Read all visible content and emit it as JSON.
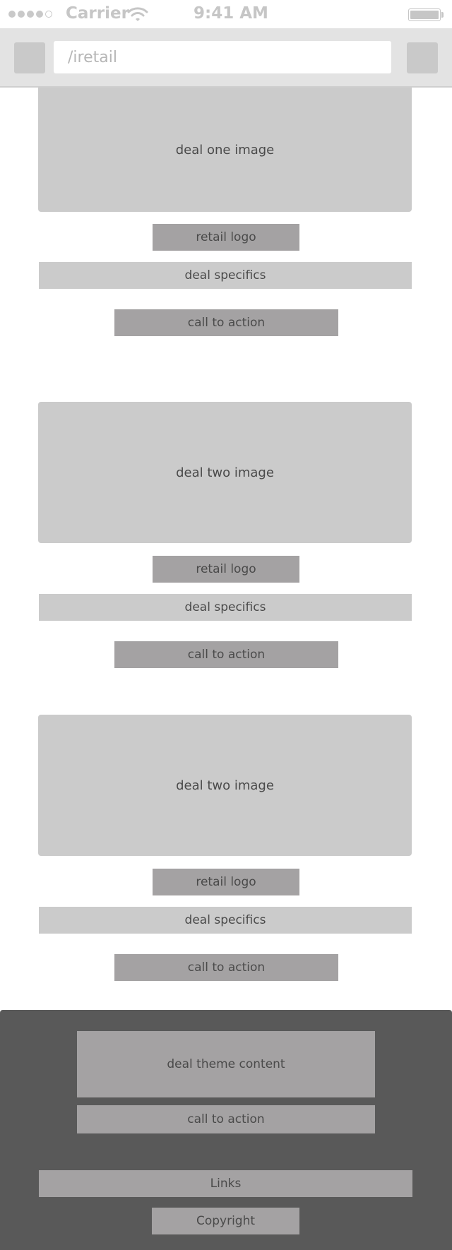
{
  "status_bar": {
    "carrier": "Carrier",
    "time": "9:41 AM",
    "signal_bars_filled": 4,
    "signal_bars_total": 5
  },
  "browser": {
    "url": "/iretail"
  },
  "deals": [
    {
      "image_label": "deal one image",
      "logo_label": "retail logo",
      "specifics_label": "deal specifics",
      "cta_label": "call to action"
    },
    {
      "image_label": "deal two image",
      "logo_label": "retail logo",
      "specifics_label": "deal specifics",
      "cta_label": "call to action"
    },
    {
      "image_label": "deal two image",
      "logo_label": "retail logo",
      "specifics_label": "deal specifics",
      "cta_label": "call to action"
    }
  ],
  "footer": {
    "theme_content_label": "deal theme content",
    "cta_label": "call to action",
    "links_label": "Links",
    "copyright_label": "Copyright"
  },
  "colors": {
    "placeholder_light": "#cbcbcb",
    "placeholder_dark": "#a4a2a3",
    "footer_bg": "#595959",
    "browser_bar_bg": "#e3e3e3"
  },
  "icons": {
    "wifi": "wifi-icon",
    "battery": "battery-icon",
    "signal": "signal-dots-icon"
  }
}
